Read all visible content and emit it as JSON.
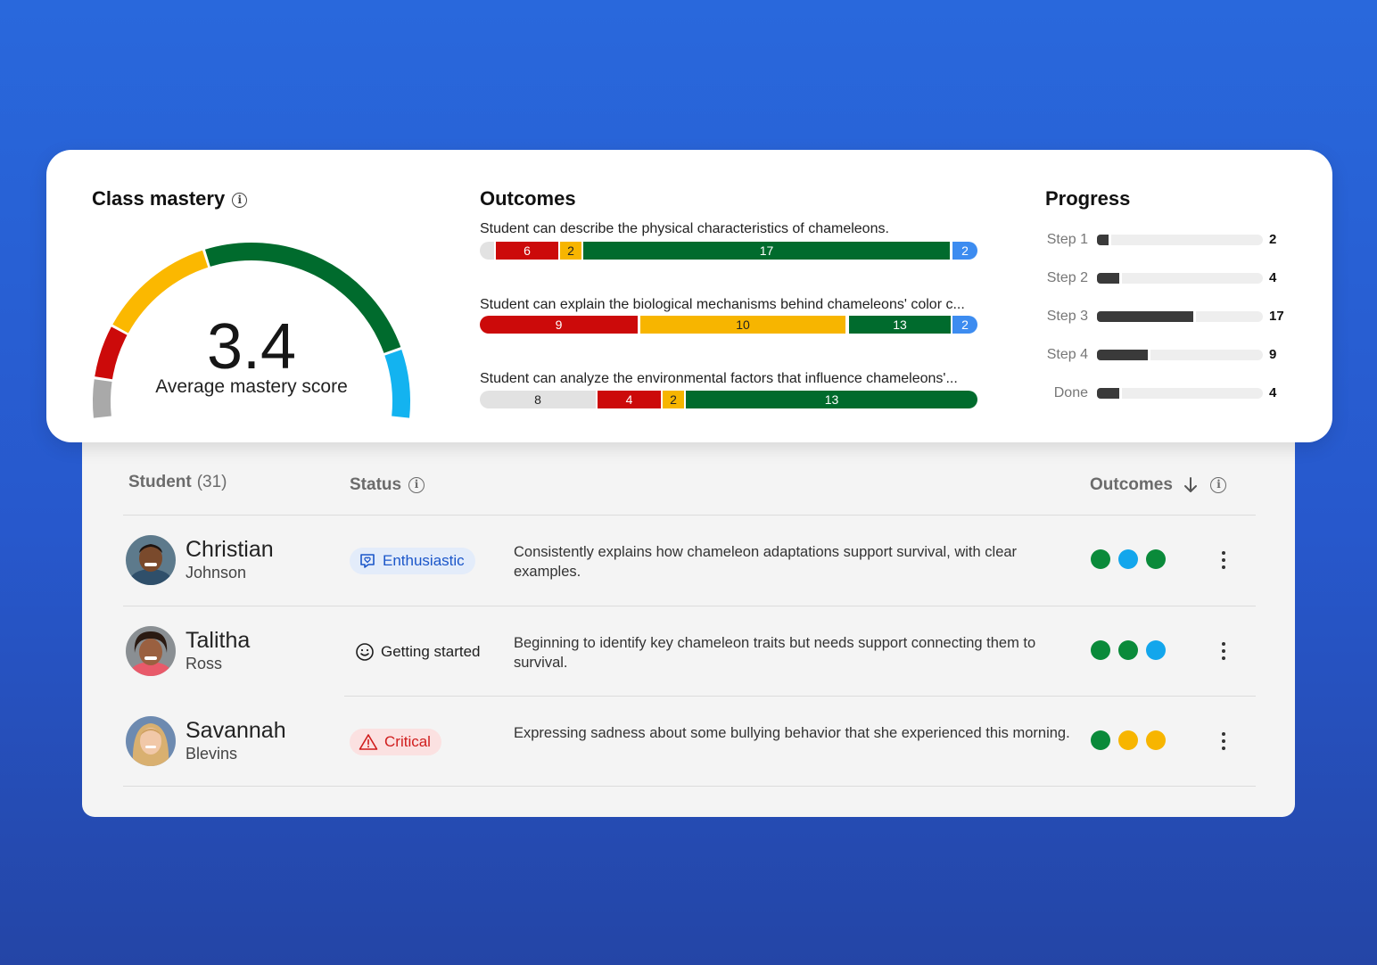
{
  "class_mastery": {
    "title": "Class mastery",
    "score": "3.4",
    "score_label": "Average mastery score",
    "gauge_value": 3.4
  },
  "outcomes": {
    "title": "Outcomes",
    "items": [
      {
        "label": "Student can describe the physical characteristics of chameleons.",
        "segments": [
          {
            "value": "",
            "color": "#e2e2e2"
          },
          {
            "value": "6",
            "color": "#cc0a0a"
          },
          {
            "value": "2",
            "color": "#f7b500"
          },
          {
            "value": "17",
            "color": "#006b2d"
          },
          {
            "value": "2",
            "color": "#3d8cf0"
          }
        ]
      },
      {
        "label": "Student can explain the biological mechanisms behind chameleons' color c...",
        "segments": [
          {
            "value": "9",
            "color": "#cc0a0a"
          },
          {
            "value": "10",
            "color": "#f7b500"
          },
          {
            "value": "13",
            "color": "#006b2d"
          },
          {
            "value": "2",
            "color": "#3d8cf0"
          }
        ]
      },
      {
        "label": "Student can analyze the environmental factors that influence chameleons'...",
        "segments": [
          {
            "value": "8",
            "color": "#e2e2e2"
          },
          {
            "value": "4",
            "color": "#cc0a0a"
          },
          {
            "value": "2",
            "color": "#f7b500"
          },
          {
            "value": "13",
            "color": "#006b2d"
          }
        ]
      }
    ]
  },
  "progress": {
    "title": "Progress",
    "steps": [
      {
        "label": "Step 1",
        "value": "2"
      },
      {
        "label": "Step 2",
        "value": "4"
      },
      {
        "label": "Step 3",
        "value": "17"
      },
      {
        "label": "Step 4",
        "value": "9"
      },
      {
        "label": "Done",
        "value": "4"
      }
    ]
  },
  "table": {
    "student_header": "Student",
    "student_count": "(31)",
    "status_header": "Status",
    "outcomes_header": "Outcomes",
    "rows": [
      {
        "first": "Christian",
        "last": "Johnson",
        "status": "Enthusiastic",
        "note": "Consistently explains how chameleon adaptations support survival, with clear examples.",
        "dots": [
          "#0a8a3a",
          "#13a6ec",
          "#0a8a3a"
        ]
      },
      {
        "first": "Talitha",
        "last": "Ross",
        "status": "Getting started",
        "note": "Beginning to identify key chameleon traits but needs support connecting them to survival.",
        "dots": [
          "#0a8a3a",
          "#0a8a3a",
          "#13a6ec"
        ]
      },
      {
        "first": "Savannah",
        "last": "Blevins",
        "status": "Critical",
        "note": "Expressing sadness about some bullying behavior that she experienced this morning.",
        "dots": [
          "#0a8a3a",
          "#f7b500",
          "#f7b500"
        ]
      }
    ]
  }
}
